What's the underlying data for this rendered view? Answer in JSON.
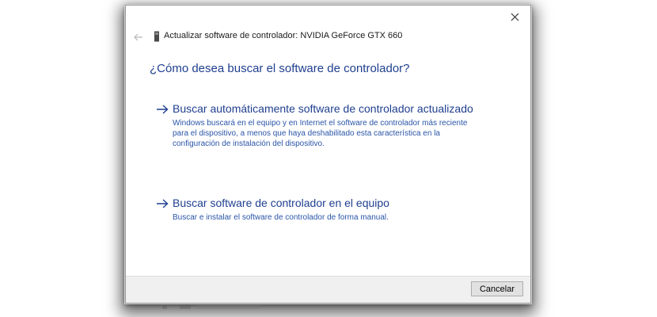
{
  "window": {
    "title": "Actualizar software de controlador: NVIDIA GeForce GTX 660"
  },
  "icons": {
    "close": "close-icon",
    "back": "back-arrow-icon",
    "device": "device-icon",
    "option_arrow": "right-arrow-icon"
  },
  "colors": {
    "link": "#1f3f8f",
    "link_description": "#2a55a8",
    "footer": "#f0f0f0"
  },
  "main": {
    "heading": "¿Cómo desea buscar el software de controlador?",
    "options": [
      {
        "title": "Buscar automáticamente software de controlador actualizado",
        "description": "Windows buscará en el equipo y en Internet el software de controlador más reciente para el dispositivo, a menos que haya deshabilitado esta característica en la configuración de instalación del dispositivo."
      },
      {
        "title": "Buscar software de controlador en el equipo",
        "description": "Buscar e instalar el software de controlador de forma manual."
      }
    ]
  },
  "footer": {
    "cancel_label": "Cancelar"
  }
}
